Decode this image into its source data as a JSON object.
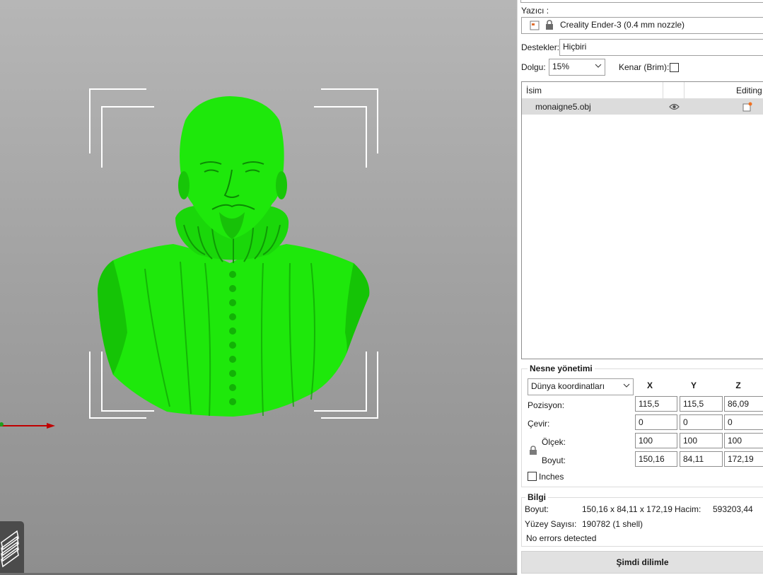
{
  "printer": {
    "label": "Yazıcı :",
    "value": "Creality Ender-3 (0.4 mm nozzle)"
  },
  "supports": {
    "label": "Destekler:",
    "value": "Hiçbiri"
  },
  "infill": {
    "label": "Dolgu:",
    "value": "15%"
  },
  "brim": {
    "label": "Kenar (Brim):",
    "checked": false
  },
  "object_list": {
    "columns": [
      "İsim",
      "Editing"
    ],
    "rows": [
      {
        "name": "monaigne5.obj"
      }
    ]
  },
  "object_manipulation": {
    "title": "Nesne yönetimi",
    "coord_system": "Dünya koordinatları",
    "axes": [
      "X",
      "Y",
      "Z"
    ],
    "rows": [
      {
        "label": "Pozisyon:",
        "values": [
          "115,5",
          "115,5",
          "86,09"
        ]
      },
      {
        "label": "Çevir:",
        "values": [
          "0",
          "0",
          "0"
        ]
      },
      {
        "label": "Ölçek:",
        "values": [
          "100",
          "100",
          "100"
        ]
      },
      {
        "label": "Boyut:",
        "values": [
          "150,16",
          "84,11",
          "172,19"
        ]
      }
    ],
    "inches_label": "Inches"
  },
  "info": {
    "title": "Bilgi",
    "size_label": "Boyut:",
    "size_value": "150,16 x 84,11 x 172,19",
    "volume_label": "Hacim:",
    "volume_value": "593203,44",
    "facets_label": "Yüzey Sayısı:",
    "facets_value": "190782 (1 shell)",
    "errors": "No errors detected"
  },
  "slice_button": "Şimdi dilimle",
  "colors": {
    "model": "#1ee80b",
    "viewport_top": "#b6b6b6",
    "viewport_bottom": "#8e8e8e",
    "axis_x": "#c00000",
    "axis_y": "#1ea01e"
  }
}
